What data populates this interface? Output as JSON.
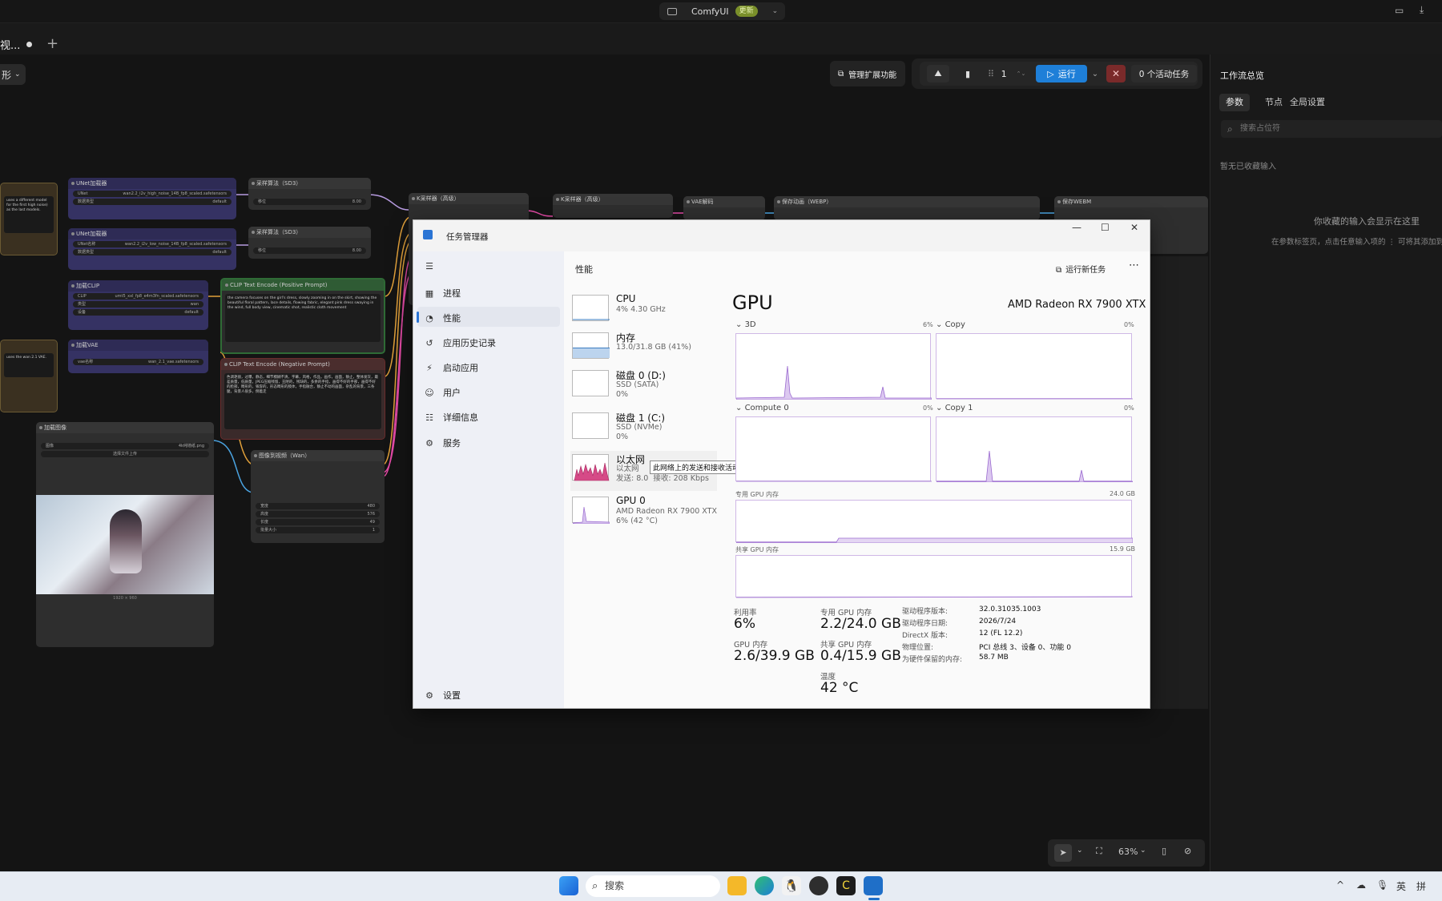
{
  "comfy": {
    "app_name": "ComfyUI",
    "update_badge": "更新",
    "tab_title": "视...",
    "tab_add": "+",
    "view_select": "形",
    "manage_ext": "管理扩展功能",
    "batch_count": "1",
    "run": "运行",
    "stop": "✕",
    "active_tasks": "0 个活动任务",
    "zoom": "63%",
    "nodes": {
      "unet1_title": "UNet加载器",
      "unet1_row1_l": "UNet",
      "unet1_row1_v": "wan2.2_i2v_high_noise_14B_fp8_scaled.safetensors",
      "unet1_row2_l": "数据类型",
      "unet1_row2_v": "default",
      "unet2_title": "UNet加载器",
      "unet2_row1_l": "UNet名称",
      "unet2_row1_v": "wan2.2_i2v_low_noise_14B_fp8_scaled.safetensors",
      "unet2_row2_l": "数据类型",
      "unet2_row2_v": "default",
      "sd3a_title": "采样算法（SD3）",
      "sd3a_row_l": "移位",
      "sd3a_row_v": "8.00",
      "sd3b_title": "采样算法（SD3）",
      "sd3b_row_l": "移位",
      "sd3b_row_v": "8.00",
      "clip_title": "加载CLIP",
      "clip_row1_l": "CLIP",
      "clip_row1_v": "umt5_xxl_fp8_e4m3fn_scaled.safetensors",
      "clip_row2_l": "类型",
      "clip_row2_v": "wan",
      "clip_row3_l": "设备",
      "clip_row3_v": "default",
      "vae_title": "加载VAE",
      "vae_row_l": "vae名称",
      "vae_row_v": "wan_2.1_vae.safetensors",
      "pos_title": "CLIP Text Encode (Positive Prompt)",
      "pos_text": "the camera focuses on the girl's dress, slowly zooming in on the skirt, showing the beautiful floral pattern, lace details, flowing fabric, elegant pink dress swaying in the wind, full body view, cinematic shot, realistic cloth movement",
      "neg_title": "CLIP Text Encode (Negative Prompt)",
      "neg_text": "色调艳丽，过曝，静态，细节模糊不清，字幕，风格，作品，画作，画面，静止，整体发灰，最差质量，低质量，JPEG压缩残留，丑陋的，残缺的，多余的手指，画得不好的手部，画得不好的脸部，畸形的，毁容的，形态畸形的肢体，手指融合，静止不动的画面，杂乱的背景，三条腿，背景人很多，倒着走",
      "ksa_title": "K采样器（高级）",
      "ksb_title": "K采样器（高级）",
      "vaedec_title": "VAE解码",
      "save_webp_title": "保存动画（WEBP）",
      "save_webm_title": "保存WEBM",
      "loadimg_title": "加载图像",
      "loadimg_row_l": "图像",
      "loadimg_row_v": "4k纯墙纸.png",
      "loadimg_btn": "选择文件上传",
      "loadimg_caption": "1920 × 960",
      "i2v_title": "图像到视频（Wan）",
      "i2v_w_l": "宽度",
      "i2v_w_v": "480",
      "i2v_h_l": "高度",
      "i2v_h_v": "576",
      "i2v_len_l": "长度",
      "i2v_len_v": "49",
      "i2v_batch_l": "批量大小",
      "i2v_batch_v": "1",
      "note1": "uses a different model for the first high noise) as the last models.",
      "note2": "uses the wan 2.1 VAE."
    },
    "right_panel": {
      "title": "工作流总览",
      "tabs": [
        "参数",
        "节点",
        "全局设置"
      ],
      "search_placeholder": "搜索占位符",
      "empty": "暂无已收藏输入",
      "hint1": "你收藏的输入会显示在这里",
      "hint2": "在参数标签页，点击任意输入项的 ⋮ 可将其添加到"
    }
  },
  "task_manager": {
    "title": "任务管理器",
    "window_controls": [
      "—",
      "☐",
      "✕"
    ],
    "nav": [
      {
        "icon": "☰",
        "label": ""
      },
      {
        "icon": "▦",
        "label": "进程"
      },
      {
        "icon": "◔",
        "label": "性能"
      },
      {
        "icon": "↺",
        "label": "应用历史记录"
      },
      {
        "icon": "⚡",
        "label": "启动应用"
      },
      {
        "icon": "☺",
        "label": "用户"
      },
      {
        "icon": "☷",
        "label": "详细信息"
      },
      {
        "icon": "⚙",
        "label": "服务"
      }
    ],
    "settings": "设置",
    "header": "性能",
    "run_new_task": "运行新任务",
    "more": "⋯",
    "resources": [
      {
        "name": "CPU",
        "sub": "4%  4.30 GHz"
      },
      {
        "name": "内存",
        "sub": "13.0/31.8 GB (41%)"
      },
      {
        "name": "磁盘 0 (D:)",
        "sub": "SSD (SATA)\n0%"
      },
      {
        "name": "磁盘 1 (C:)",
        "sub": "SSD (NVMe)\n0%"
      },
      {
        "name": "以太网",
        "sub": "以太网\n发送: 8.0  接收: 208 Kbps"
      },
      {
        "name": "GPU 0",
        "sub": "AMD Radeon RX 7900 XTX\n6% (42 °C)"
      }
    ],
    "tooltip": "此网络上的发送和接收活动",
    "gpu_title": "GPU",
    "gpu_model": "AMD Radeon RX 7900 XTX",
    "engines": [
      {
        "label": "3D",
        "pct": "6%"
      },
      {
        "label": "Copy",
        "pct": "0%"
      },
      {
        "label": "Compute 0",
        "pct": "0%"
      },
      {
        "label": "Copy 1",
        "pct": "0%"
      }
    ],
    "dedicated_label": "专用 GPU 内存",
    "dedicated_max": "24.0 GB",
    "shared_label": "共享 GPU 内存",
    "shared_max": "15.9 GB",
    "stats": {
      "util_l": "利用率",
      "util_v": "6%",
      "ded_l": "专用 GPU 内存",
      "ded_v": "2.2/24.0 GB",
      "gpumem_l": "GPU 内存",
      "gpumem_v": "2.6/39.9 GB",
      "shared_l": "共享 GPU 内存",
      "shared_v": "0.4/15.9 GB",
      "temp_l": "温度",
      "temp_v": "42 °C"
    },
    "info": [
      {
        "k": "驱动程序版本:",
        "v": "32.0.31035.1003"
      },
      {
        "k": "驱动程序日期:",
        "v": "2026/7/24"
      },
      {
        "k": "DirectX 版本:",
        "v": "12 (FL 12.2)"
      },
      {
        "k": "物理位置:",
        "v": "PCI 总线 3、设备 0、功能 0"
      },
      {
        "k": "为硬件保留的内存:",
        "v": "58.7 MB"
      }
    ]
  },
  "taskbar": {
    "search": "搜索",
    "ime": "英",
    "ime2": "拼",
    "caret": "^"
  }
}
